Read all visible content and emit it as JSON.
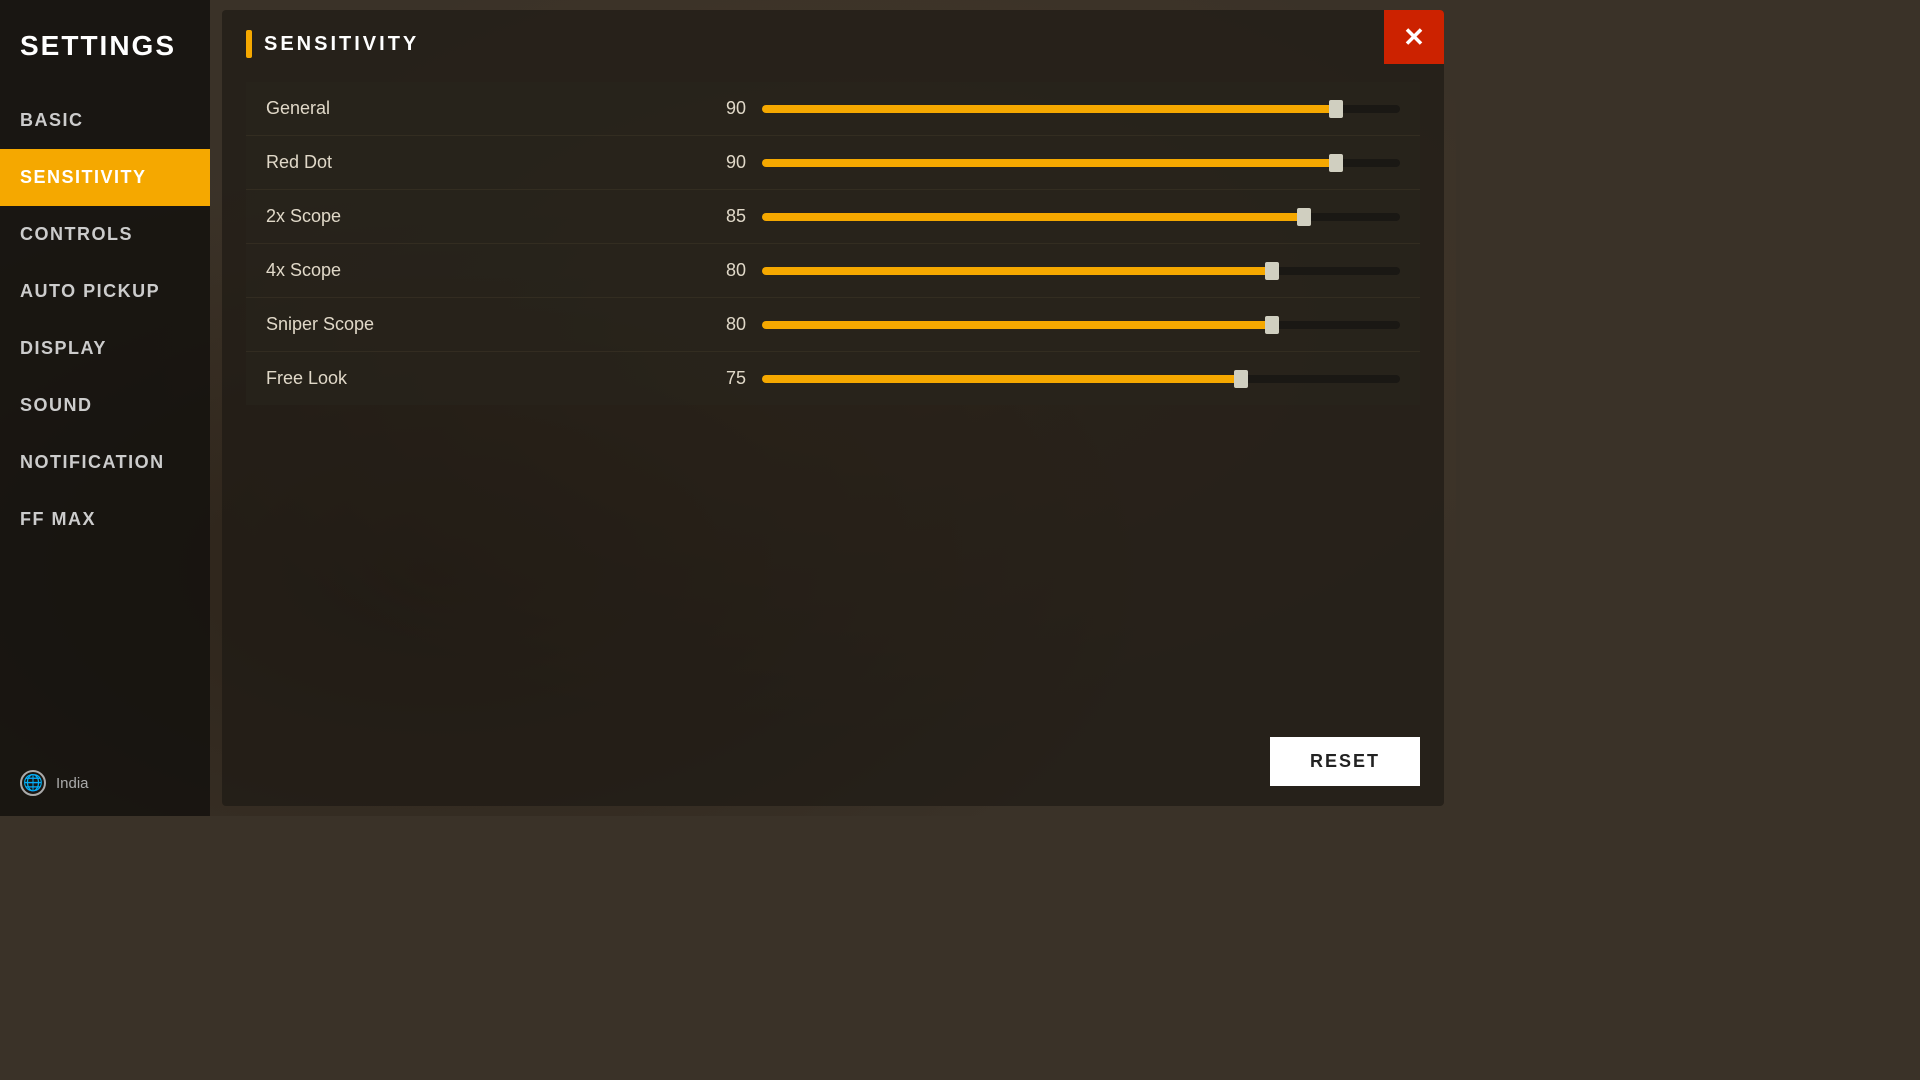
{
  "sidebar": {
    "title": "SETTINGS",
    "nav_items": [
      {
        "id": "basic",
        "label": "BASIC",
        "active": false
      },
      {
        "id": "sensitivity",
        "label": "SENSITIVITY",
        "active": true
      },
      {
        "id": "controls",
        "label": "CONTROLS",
        "active": false
      },
      {
        "id": "auto_pickup",
        "label": "AUTO PICKUP",
        "active": false
      },
      {
        "id": "display",
        "label": "DISPLAY",
        "active": false
      },
      {
        "id": "sound",
        "label": "SOUND",
        "active": false
      },
      {
        "id": "notification",
        "label": "NOTIFICATION",
        "active": false
      },
      {
        "id": "ff_max",
        "label": "FF MAX",
        "active": false
      }
    ],
    "footer": {
      "region": "India"
    }
  },
  "main": {
    "section_title": "SENSITIVITY",
    "sliders": [
      {
        "label": "General",
        "value": 90,
        "max": 100
      },
      {
        "label": "Red Dot",
        "value": 90,
        "max": 100
      },
      {
        "label": "2x Scope",
        "value": 85,
        "max": 100
      },
      {
        "label": "4x Scope",
        "value": 80,
        "max": 100
      },
      {
        "label": "Sniper Scope",
        "value": 80,
        "max": 100
      },
      {
        "label": "Free Look",
        "value": 75,
        "max": 100
      }
    ],
    "reset_button": "RESET",
    "close_icon": "✕"
  }
}
